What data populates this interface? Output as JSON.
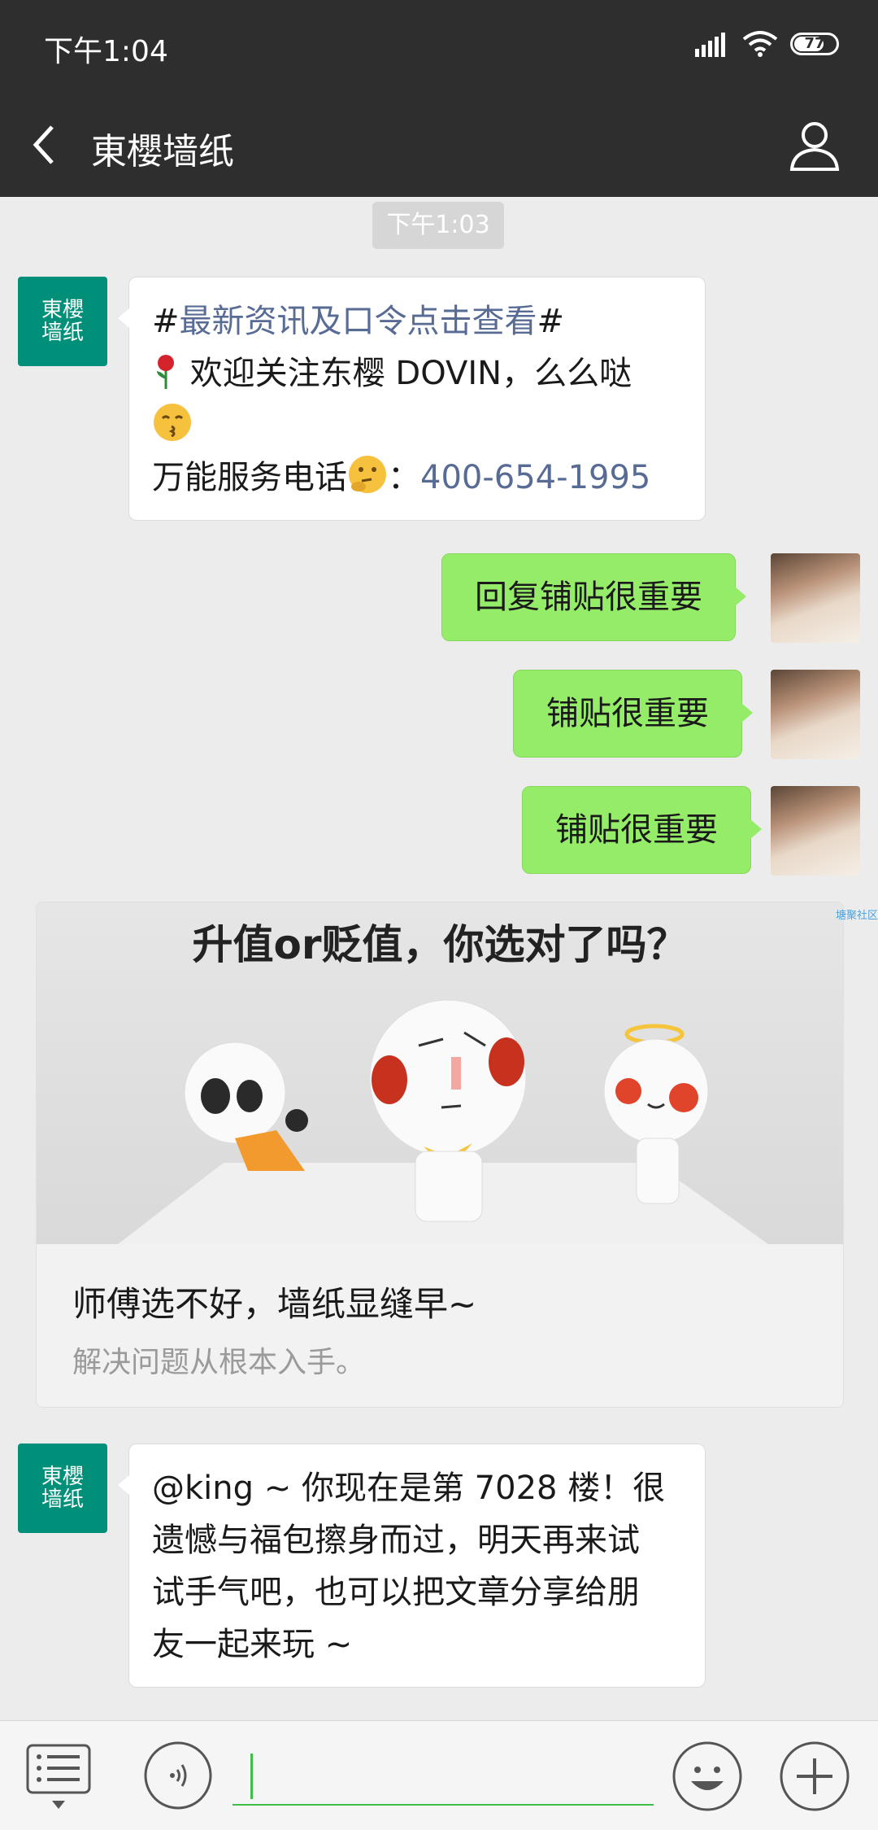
{
  "status_bar": {
    "time": "下午1:04",
    "battery": "77"
  },
  "header": {
    "title": "東櫻墙纸"
  },
  "brand_avatar": {
    "line1": "東櫻",
    "line2": "墙纸"
  },
  "timestamp": "下午1:03",
  "messages": [
    {
      "from": "official",
      "hashtag_open": "#",
      "hashtag_link": "最新资讯及口令点击查看",
      "hashtag_close": "#",
      "welcome": "欢迎关注东樱 DOVIN，么么哒",
      "phone_label": "万能服务电话",
      "phone_sep": "：",
      "phone": "400-654-1995"
    },
    {
      "from": "me",
      "text": "回复铺贴很重要"
    },
    {
      "from": "me",
      "text": "铺贴很重要"
    },
    {
      "from": "me",
      "text": "铺贴很重要"
    }
  ],
  "article_card": {
    "image_headline": "升值or贬值，你选对了吗？",
    "title": "师傅选不好，墙纸显缝早~",
    "description": "解决问题从根本入手。",
    "watermark": "塘聚社区"
  },
  "reply": {
    "line1": "@king ~ 你现在是第 7028 楼！很",
    "line2": "遗憾与福包擦身而过，明天再来试",
    "line3": "试手气吧，也可以把文章分享给朋",
    "line4": "友一起来玩 ~"
  },
  "colors": {
    "header_bg": "#2e2e2e",
    "out_bubble": "#95ec69",
    "brand": "#00907a",
    "link": "#576b95"
  }
}
